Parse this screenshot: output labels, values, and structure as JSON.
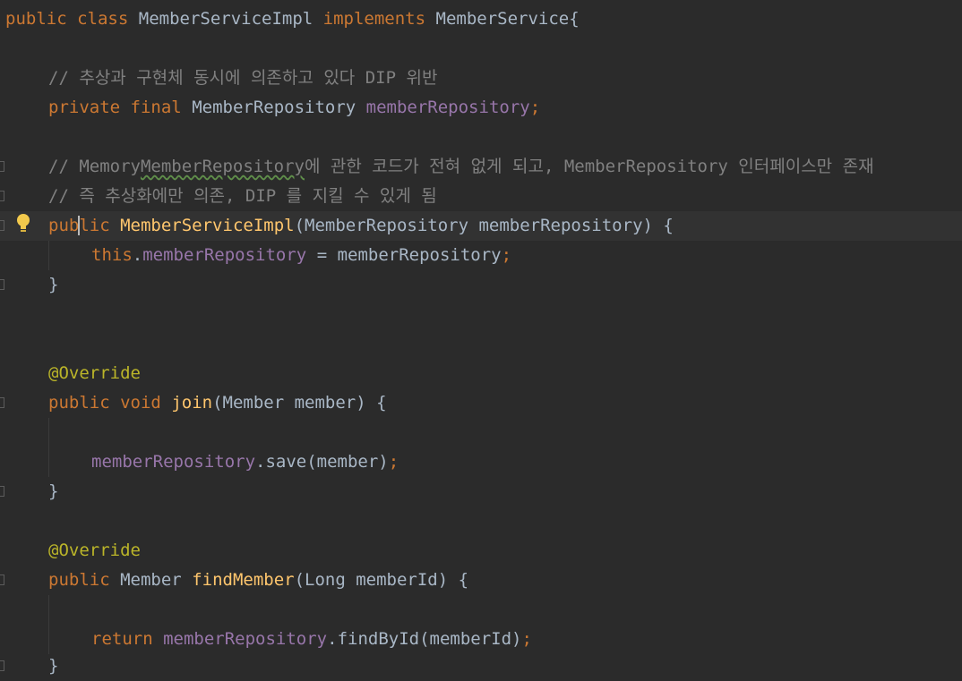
{
  "editor": {
    "lines": {
      "class_decl": {
        "public": "public",
        "class": "class",
        "name": "MemberServiceImpl",
        "implements": "implements",
        "iface": "MemberService",
        "brace": "{"
      },
      "comment1": "// 추상과 구현체 동시에 의존하고 있다 DIP 위반",
      "field": {
        "private": "private",
        "final": "final",
        "type": "MemberRepository",
        "name": "memberRepository",
        "semi": ";"
      },
      "comment2_a": "// Memory",
      "comment2_b": "MemberRepository",
      "comment2_c": "에 관한 코드가 전혀 없게 되고, MemberRepository 인터페이스만 존재",
      "comment3": "// 즉 추상화에만 의존, DIP 를 지킬 수 있게 됨",
      "ctor": {
        "pub_a": "pub",
        "pub_b": "lic",
        "name": "MemberServiceImpl",
        "params": "(MemberRepository memberRepository) {"
      },
      "assign": {
        "this": "this",
        "dot": ".",
        "field": "memberRepository",
        "rest": " = memberRepository",
        "semi": ";"
      },
      "close1": "}",
      "override1": "@Override",
      "join": {
        "public": "public",
        "void": "void",
        "name": "join",
        "params": "(Member member) {"
      },
      "save": {
        "field": "memberRepository",
        "call": ".save(member)",
        "semi": ";"
      },
      "close2": "}",
      "override2": "@Override",
      "find": {
        "public": "public",
        "type": "Member",
        "name": "findMember",
        "params": "(Long memberId) {"
      },
      "ret": {
        "return": "return",
        "field": "memberRepository",
        "call": ".findById(memberId)",
        "semi": ";"
      },
      "close3": "}"
    },
    "colors": {
      "background": "#2b2b2b",
      "keyword": "#cc7832",
      "field": "#9876aa",
      "method": "#ffc66d",
      "annotation": "#bbb529",
      "comment": "#808080",
      "text": "#a9b7c6"
    },
    "icons": {
      "intention": "lightbulb-icon"
    }
  }
}
